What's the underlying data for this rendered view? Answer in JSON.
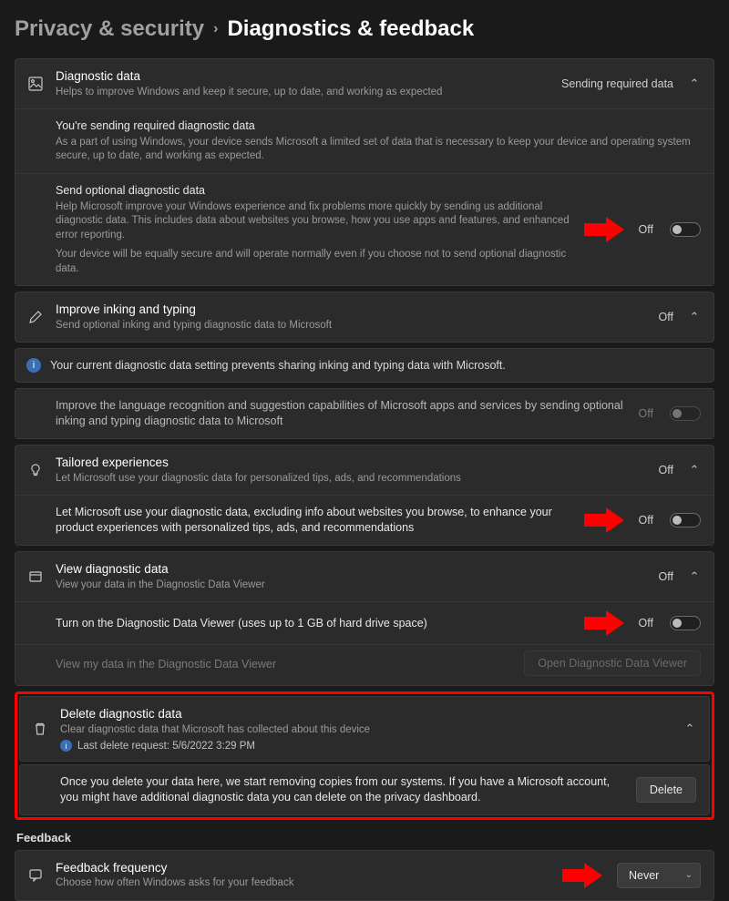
{
  "breadcrumb": {
    "parent": "Privacy & security",
    "current": "Diagnostics & feedback"
  },
  "diag": {
    "title": "Diagnostic data",
    "desc": "Helps to improve Windows and keep it secure, up to date, and working as expected",
    "status": "Sending required data",
    "required_title": "You're sending required diagnostic data",
    "required_desc": "As a part of using Windows, your device sends Microsoft a limited set of data that is necessary to keep your device and operating system secure, up to date, and working as expected.",
    "optional_title": "Send optional diagnostic data",
    "optional_desc": "Help Microsoft improve your Windows experience and fix problems more quickly by sending us additional diagnostic data. This includes data about websites you browse, how you use apps and features, and enhanced error reporting.",
    "optional_note": "Your device will be equally secure and will operate normally even if you choose not to send optional diagnostic data.",
    "optional_state": "Off"
  },
  "inking": {
    "title": "Improve inking and typing",
    "desc": "Send optional inking and typing diagnostic data to Microsoft",
    "status": "Off",
    "banner": "Your current diagnostic data setting prevents sharing inking and typing data with Microsoft.",
    "sub_title": "Improve the language recognition and suggestion capabilities of Microsoft apps and services by sending optional inking and typing diagnostic data to Microsoft",
    "sub_state": "Off"
  },
  "tailored": {
    "title": "Tailored experiences",
    "desc": "Let Microsoft use your diagnostic data for personalized tips, ads, and recommendations",
    "status": "Off",
    "sub_title": "Let Microsoft use your diagnostic data, excluding info about websites you browse, to enhance your product experiences with personalized tips, ads, and recommendations",
    "sub_state": "Off"
  },
  "view": {
    "title": "View diagnostic data",
    "desc": "View your data in the Diagnostic Data Viewer",
    "status": "Off",
    "sub_title": "Turn on the Diagnostic Data Viewer (uses up to 1 GB of hard drive space)",
    "sub_state": "Off",
    "link": "View my data in the Diagnostic Data Viewer",
    "button": "Open Diagnostic Data Viewer"
  },
  "delete": {
    "title": "Delete diagnostic data",
    "desc": "Clear diagnostic data that Microsoft has collected about this device",
    "last": "Last delete request: 5/6/2022 3:29 PM",
    "body": "Once you delete your data here, we start removing copies from our systems. If you have a Microsoft account, you might have additional diagnostic data you can delete on the privacy dashboard.",
    "button": "Delete"
  },
  "feedback": {
    "section": "Feedback",
    "title": "Feedback frequency",
    "desc": "Choose how often Windows asks for your feedback",
    "value": "Never"
  }
}
